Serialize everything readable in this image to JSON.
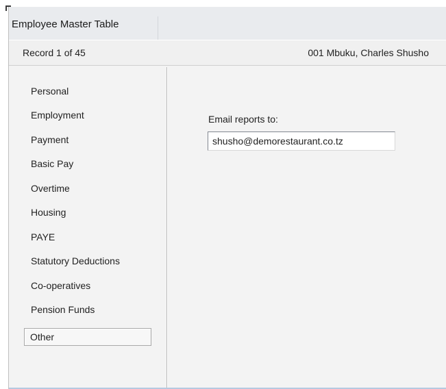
{
  "window": {
    "title": "Employee Master Table"
  },
  "header": {
    "record_label": "Record 1 of 45",
    "employee_label": "001  Mbuku, Charles Shusho"
  },
  "sidebar": {
    "items": [
      {
        "label": "Personal",
        "selected": false
      },
      {
        "label": "Employment",
        "selected": false
      },
      {
        "label": "Payment",
        "selected": false
      },
      {
        "label": "Basic Pay",
        "selected": false
      },
      {
        "label": "Overtime",
        "selected": false
      },
      {
        "label": "Housing",
        "selected": false
      },
      {
        "label": "PAYE",
        "selected": false
      },
      {
        "label": "Statutory Deductions",
        "selected": false
      },
      {
        "label": "Co-operatives",
        "selected": false
      },
      {
        "label": "Pension Funds",
        "selected": false
      },
      {
        "label": "Other",
        "selected": true
      }
    ]
  },
  "main": {
    "email_label": "Email reports to:",
    "email_value": "shusho@demorestaurant.co.tz"
  },
  "colors": {
    "window_bg": "#f3f3f3",
    "title_bg": "#e9ebee",
    "accent_edge": "#b5c9e0"
  }
}
